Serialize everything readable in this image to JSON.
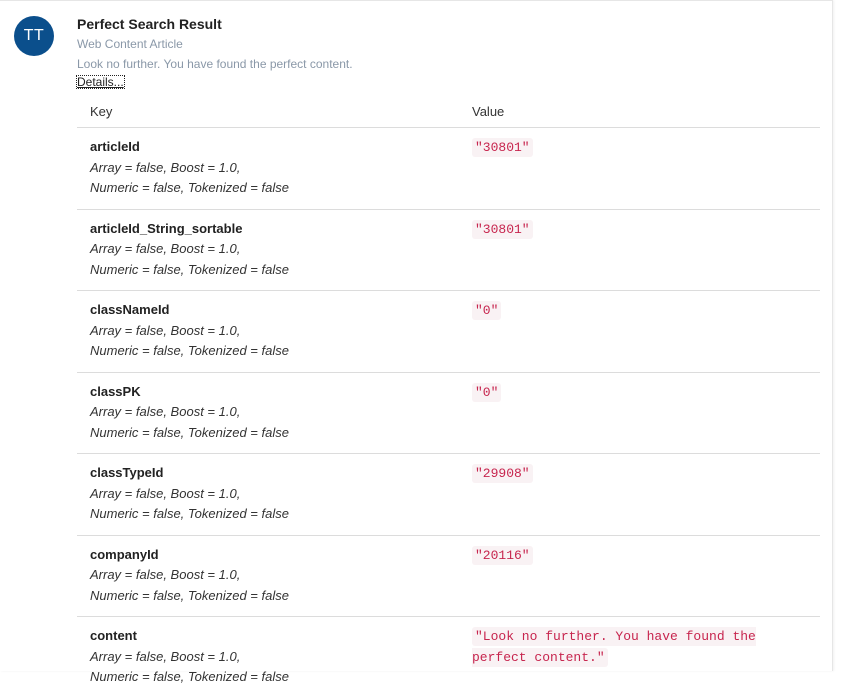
{
  "result": {
    "avatar_initials": "TT",
    "title": "Perfect Search Result",
    "type": "Web Content Article",
    "summary": "Look no further. You have found the perfect content.",
    "details_label": "Details..."
  },
  "table": {
    "headers": {
      "key": "Key",
      "value": "Value"
    },
    "rows": [
      {
        "name": "articleId",
        "meta1": "Array = false, Boost = 1.0,",
        "meta2": "Numeric = false, Tokenized = false",
        "value": "\"30801\""
      },
      {
        "name": "articleId_String_sortable",
        "meta1": "Array = false, Boost = 1.0,",
        "meta2": "Numeric = false, Tokenized = false",
        "value": "\"30801\""
      },
      {
        "name": "classNameId",
        "meta1": "Array = false, Boost = 1.0,",
        "meta2": "Numeric = false, Tokenized = false",
        "value": "\"0\""
      },
      {
        "name": "classPK",
        "meta1": "Array = false, Boost = 1.0,",
        "meta2": "Numeric = false, Tokenized = false",
        "value": "\"0\""
      },
      {
        "name": "classTypeId",
        "meta1": "Array = false, Boost = 1.0,",
        "meta2": "Numeric = false, Tokenized = false",
        "value": "\"29908\""
      },
      {
        "name": "companyId",
        "meta1": "Array = false, Boost = 1.0,",
        "meta2": "Numeric = false, Tokenized = false",
        "value": "\"20116\""
      },
      {
        "name": "content",
        "meta1": "Array = false, Boost = 1.0,",
        "meta2": "Numeric = false, Tokenized = false",
        "value": "\"Look no further. You have found the perfect content.\""
      }
    ]
  },
  "colors": {
    "avatar_bg": "#0b4f8c",
    "code_text": "#c7254e",
    "code_bg": "#f9f2f4",
    "muted_text": "#8a98a8"
  }
}
